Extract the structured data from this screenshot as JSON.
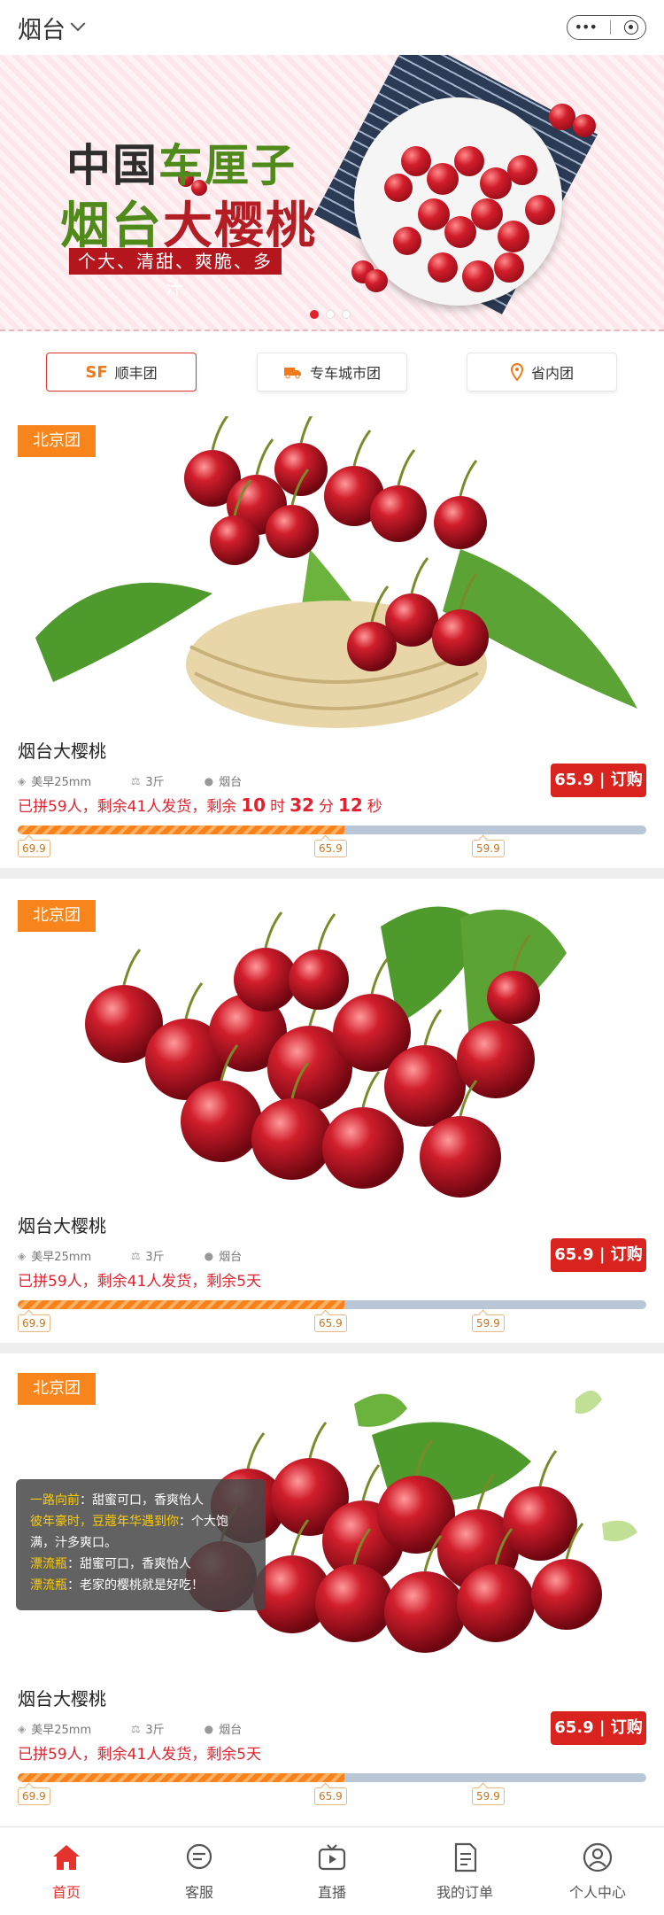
{
  "header": {
    "city": "烟台",
    "menu_dots": "•••"
  },
  "banner": {
    "line1_a": "中国",
    "line1_b": "车厘子",
    "line2_a": "烟台",
    "line2_b": "大樱桃",
    "tag": "个大、清甜、爽脆、多汁",
    "slide_count": 3,
    "active_slide": 1
  },
  "filters": [
    {
      "label": "顺丰团",
      "icon": "sf-logo-icon",
      "active": true
    },
    {
      "label": "专车城市团",
      "icon": "truck-icon",
      "active": false
    },
    {
      "label": "省内团",
      "icon": "location-pin-icon",
      "active": false
    }
  ],
  "products": [
    {
      "group": "北京团",
      "name": "烟台大樱桃",
      "size": "美早25mm",
      "weight": "3斤",
      "origin": "烟台",
      "status_prefix": "已拼59人，剩余41人发货，剩余",
      "countdown": {
        "h": "10",
        "h_unit": "时",
        "m": "32",
        "m_unit": "分",
        "s": "12",
        "s_unit": "秒"
      },
      "buy_label": "65.9 | 订购",
      "progress": 0.52,
      "ticks": [
        "69.9",
        "65.9",
        "59.9"
      ]
    },
    {
      "group": "北京团",
      "name": "烟台大樱桃",
      "size": "美早25mm",
      "weight": "3斤",
      "origin": "烟台",
      "status": "已拼59人，剩余41人发货，剩余5天",
      "buy_label": "65.9 | 订购",
      "progress": 0.52,
      "ticks": [
        "69.9",
        "65.9",
        "59.9"
      ]
    },
    {
      "group": "北京团",
      "name": "烟台大樱桃",
      "size": "美早25mm",
      "weight": "3斤",
      "origin": "烟台",
      "status": "已拼59人，剩余41人发货，剩余5天",
      "buy_label": "65.9 | 订购",
      "progress": 0.52,
      "ticks": [
        "69.9",
        "65.9",
        "59.9"
      ],
      "review": [
        {
          "user": "一路向前",
          "text": "：甜蜜可口，香爽怡人"
        },
        {
          "user": "彼年豪时，豆蔻年华遇到你",
          "text": "：个大饱满，汁多爽口。"
        },
        {
          "user": "漂流瓶",
          "text": "：甜蜜可口，香爽怡人"
        },
        {
          "user": "漂流瓶",
          "text": "：老家的樱桃就是好吃！"
        }
      ]
    }
  ],
  "nav": [
    {
      "label": "首页",
      "icon": "home-icon",
      "active": true
    },
    {
      "label": "客服",
      "icon": "chat-bubble-icon",
      "active": false
    },
    {
      "label": "直播",
      "icon": "tv-play-icon",
      "active": false
    },
    {
      "label": "我的订单",
      "icon": "order-document-icon",
      "active": false
    },
    {
      "label": "个人中心",
      "icon": "user-profile-icon",
      "active": false
    }
  ],
  "colors": {
    "brand_red": "#d9231e",
    "tag_orange": "#f7851c",
    "progress_orange": "#f7821c"
  }
}
